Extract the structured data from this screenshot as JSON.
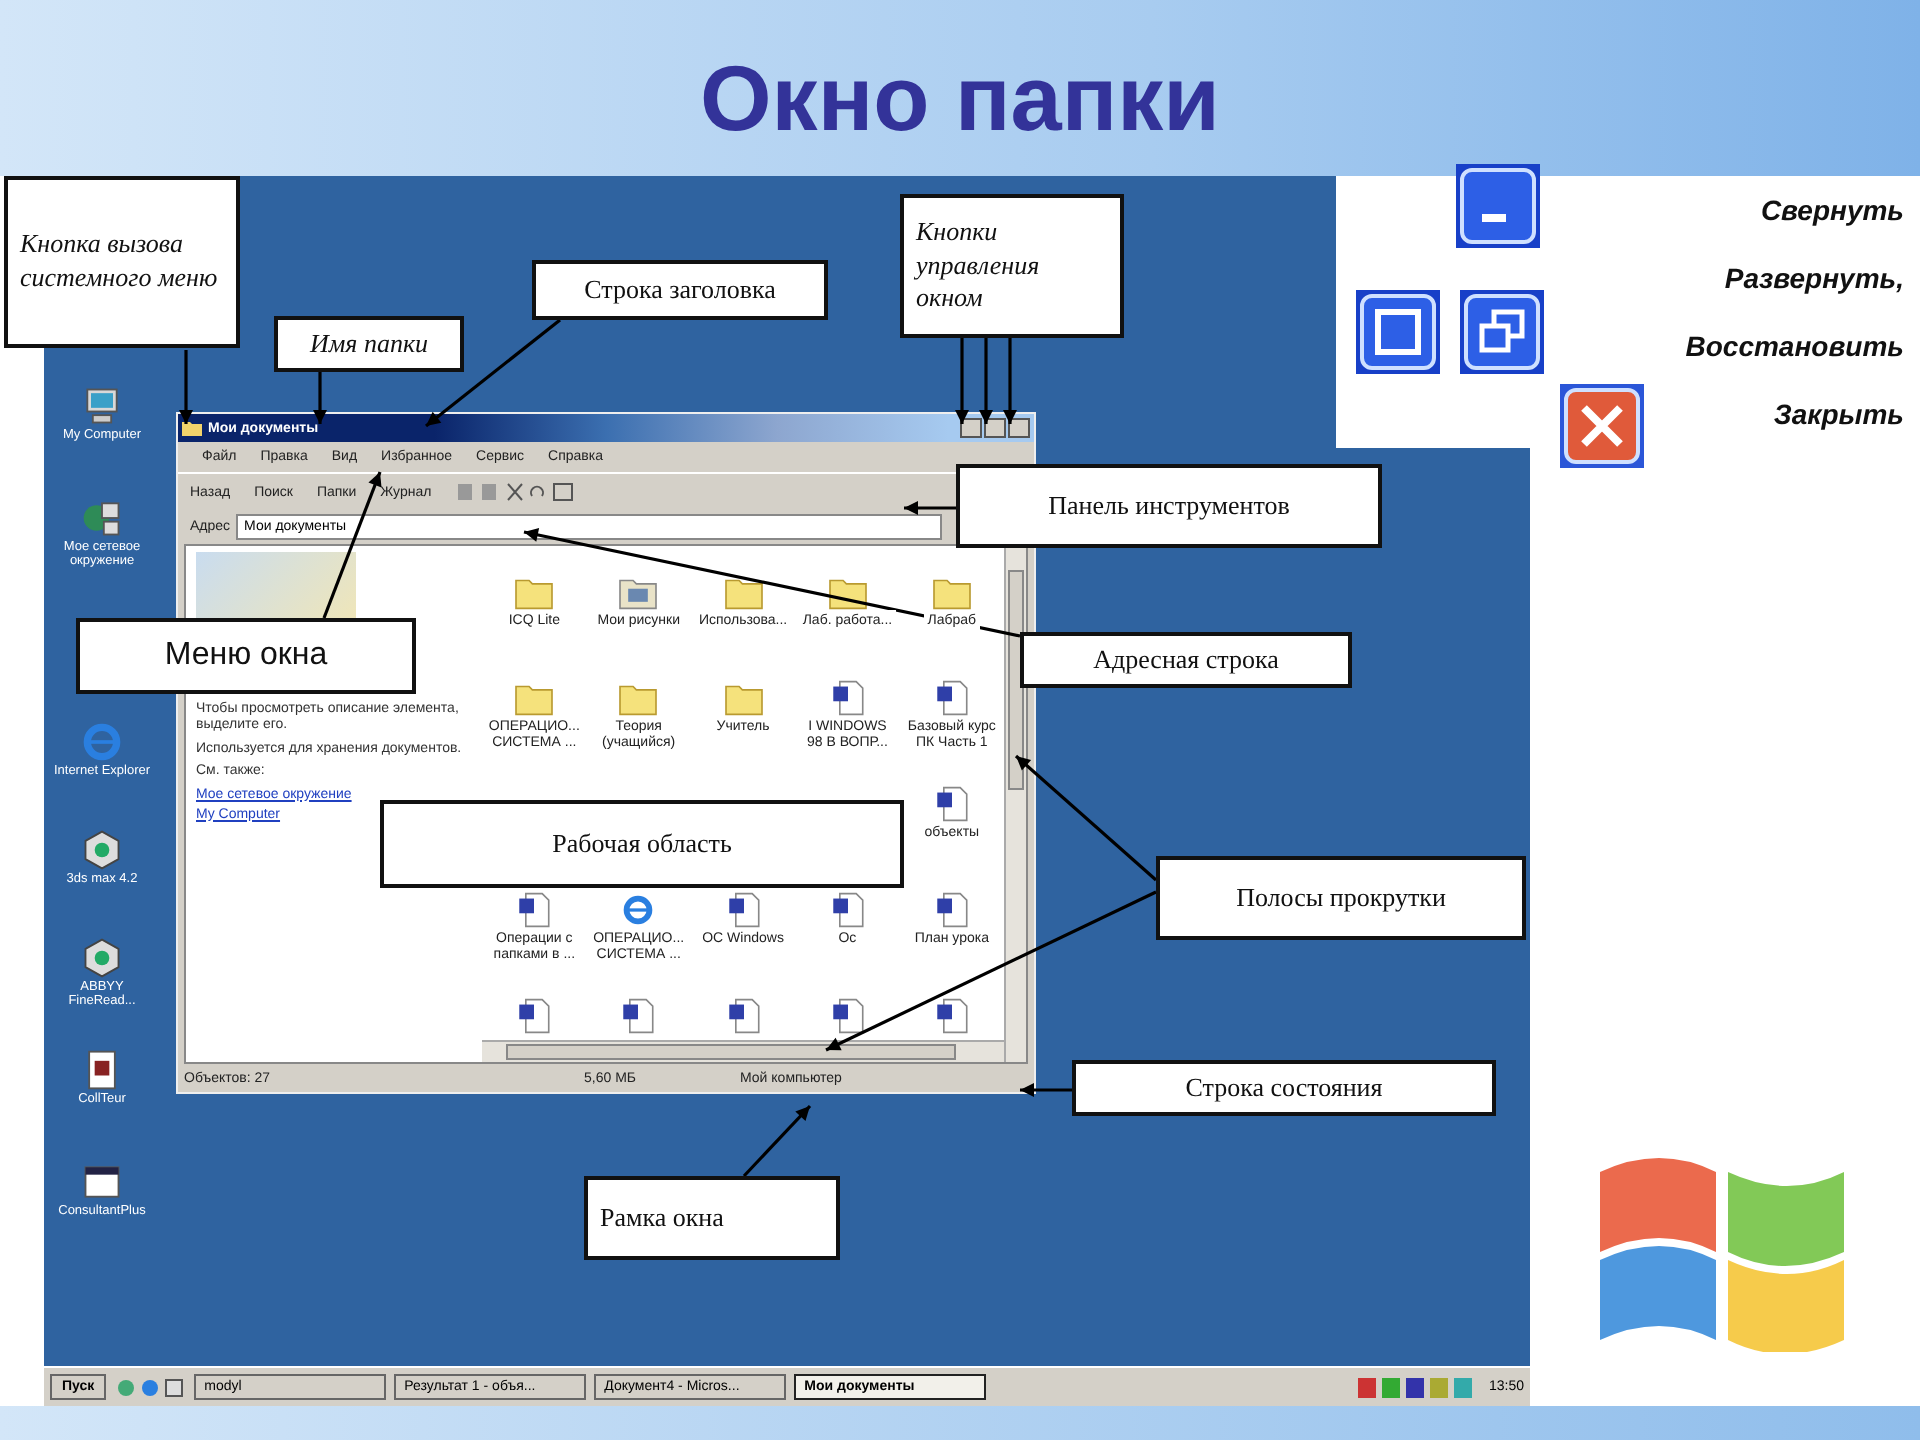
{
  "title": "Окно папки",
  "legend": {
    "labels": [
      "Свернуть",
      "Развернуть,",
      "Восстановить",
      "Закрыть"
    ],
    "buttons": [
      {
        "kind": "minimize"
      },
      {
        "kind": "maximize"
      },
      {
        "kind": "restore"
      },
      {
        "kind": "close"
      }
    ]
  },
  "desktop": {
    "icons": [
      {
        "label": "My Computer",
        "kind": "computer"
      },
      {
        "label": "Мое сетевое окружение",
        "kind": "network"
      },
      {
        "label": "Internet Explorer",
        "kind": "ie"
      },
      {
        "label": "3ds max 4.2",
        "kind": "app"
      },
      {
        "label": "ABBYY FineRead...",
        "kind": "app"
      },
      {
        "label": "CollTeur",
        "kind": "doc"
      },
      {
        "label": "ConsultantPlus",
        "kind": "window"
      }
    ],
    "window": {
      "title": "Мои документы",
      "menu": [
        "Файл",
        "Правка",
        "Вид",
        "Избранное",
        "Сервис",
        "Справка"
      ],
      "toolbar": [
        "Назад",
        "Поиск",
        "Папки",
        "Журнал"
      ],
      "address_label": "Адрес",
      "address": "Мои документы",
      "side_texts": [
        "Чтобы просмотреть описание элемента, выделите его.",
        "Используется для хранения документов.",
        "См. также:"
      ],
      "side_links": [
        "Мое сетевое окружение",
        "My Computer"
      ],
      "file_rows": [
        [
          {
            "label": "ICQ Lite",
            "kind": "folder"
          },
          {
            "label": "Мои рисунки",
            "kind": "picture"
          },
          {
            "label": "Использова...",
            "kind": "folder"
          },
          {
            "label": "Лаб. работа...",
            "kind": "folder"
          },
          {
            "label": "Лабраб",
            "kind": "folder"
          }
        ],
        [
          {
            "label": "ОПЕРАЦИО... СИСТЕМА ...",
            "kind": "folder"
          },
          {
            "label": "Теория (учащийся)",
            "kind": "folder"
          },
          {
            "label": "Учитель",
            "kind": "folder"
          },
          {
            "label": "I WINDOWS 98 В ВОПР...",
            "kind": "doc"
          },
          {
            "label": "Базовый курс ПК Часть 1",
            "kind": "doc"
          }
        ],
        [
          {
            "label": "объекты",
            "kind": "doc"
          }
        ],
        [
          {
            "label": "Операции с папками в ...",
            "kind": "doc"
          },
          {
            "label": "ОПЕРАЦИО... СИСТЕМА ...",
            "kind": "ie"
          },
          {
            "label": "ОС Windows",
            "kind": "doc"
          },
          {
            "label": "Ос",
            "kind": "doc"
          },
          {
            "label": "План урока",
            "kind": "doc"
          }
        ],
        [
          {
            "kind": "doc"
          },
          {
            "kind": "doc"
          },
          {
            "kind": "doc"
          },
          {
            "kind": "doc"
          },
          {
            "kind": "doc"
          }
        ]
      ],
      "status": [
        "Объектов: 27",
        "5,60 МБ",
        "Мой компьютер"
      ]
    },
    "taskbar": {
      "start": "Пуск",
      "tasks": [
        {
          "label": "modyl",
          "selected": false
        },
        {
          "label": "Результат 1 - объя...",
          "selected": false
        },
        {
          "label": "Документ4 - Micros...",
          "selected": false
        },
        {
          "label": "Мои документы",
          "selected": true
        }
      ],
      "clock": "13:50"
    }
  },
  "callouts": [
    {
      "text": "Кнопка вызова системного меню",
      "italic": true
    },
    {
      "text": "Имя папки",
      "italic": true
    },
    {
      "text": "Строка заголовка",
      "italic": false
    },
    {
      "text": "Кнопки управления окном",
      "italic": true
    },
    {
      "text": "Панель инструментов",
      "italic": false
    },
    {
      "text": "Меню окна",
      "italic": false
    },
    {
      "text": "Адресная строка",
      "italic": false
    },
    {
      "text": "Рабочая область",
      "italic": false
    },
    {
      "text": "Полосы прокрутки",
      "italic": false
    },
    {
      "text": "Строка состояния",
      "italic": false
    },
    {
      "text": "Рамка окна",
      "italic": false
    }
  ]
}
